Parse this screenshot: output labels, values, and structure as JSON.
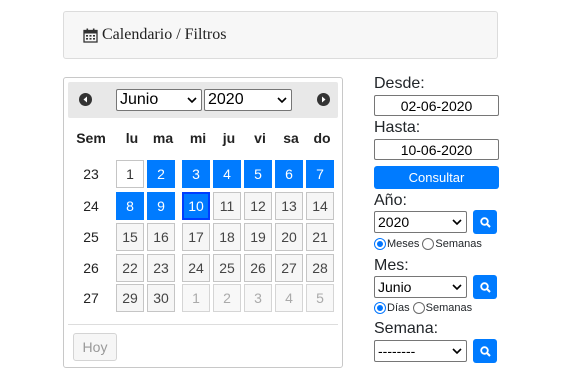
{
  "breadcrumb": {
    "icon": "calendar-icon",
    "section": "Calendario",
    "separator": "/",
    "page": "Filtros"
  },
  "calendar": {
    "selected_month": "Junio",
    "selected_year": "2020",
    "weekday_header": [
      "Sem",
      "lu",
      "ma",
      "mi",
      "ju",
      "vi",
      "sa",
      "do"
    ],
    "weeks": [
      {
        "week": "23",
        "days": [
          {
            "d": "1",
            "s": "today"
          },
          {
            "d": "2",
            "s": "selected"
          },
          {
            "d": "3",
            "s": "selected"
          },
          {
            "d": "4",
            "s": "selected"
          },
          {
            "d": "5",
            "s": "selected"
          },
          {
            "d": "6",
            "s": "selected"
          },
          {
            "d": "7",
            "s": "selected"
          }
        ]
      },
      {
        "week": "24",
        "days": [
          {
            "d": "8",
            "s": "selected"
          },
          {
            "d": "9",
            "s": "selected"
          },
          {
            "d": "10",
            "s": "selected current"
          },
          {
            "d": "11",
            "s": ""
          },
          {
            "d": "12",
            "s": ""
          },
          {
            "d": "13",
            "s": ""
          },
          {
            "d": "14",
            "s": ""
          }
        ]
      },
      {
        "week": "25",
        "days": [
          {
            "d": "15",
            "s": ""
          },
          {
            "d": "16",
            "s": ""
          },
          {
            "d": "17",
            "s": ""
          },
          {
            "d": "18",
            "s": ""
          },
          {
            "d": "19",
            "s": ""
          },
          {
            "d": "20",
            "s": ""
          },
          {
            "d": "21",
            "s": ""
          }
        ]
      },
      {
        "week": "26",
        "days": [
          {
            "d": "22",
            "s": ""
          },
          {
            "d": "23",
            "s": ""
          },
          {
            "d": "24",
            "s": ""
          },
          {
            "d": "25",
            "s": ""
          },
          {
            "d": "26",
            "s": ""
          },
          {
            "d": "27",
            "s": ""
          },
          {
            "d": "28",
            "s": ""
          }
        ]
      },
      {
        "week": "27",
        "days": [
          {
            "d": "29",
            "s": ""
          },
          {
            "d": "30",
            "s": ""
          },
          {
            "d": "1",
            "s": "other"
          },
          {
            "d": "2",
            "s": "other"
          },
          {
            "d": "3",
            "s": "other"
          },
          {
            "d": "4",
            "s": "other"
          },
          {
            "d": "5",
            "s": "other"
          }
        ]
      }
    ],
    "today_button": "Hoy"
  },
  "filters": {
    "desde_label": "Desde:",
    "desde_value": "02-06-2020",
    "hasta_label": "Hasta:",
    "hasta_value": "10-06-2020",
    "consult_button": "Consultar",
    "anio_label": "Año:",
    "anio_value": "2020",
    "anio_radio": [
      "Meses",
      "Semanas"
    ],
    "mes_label": "Mes:",
    "mes_value": "Junio",
    "mes_radio": [
      "Días",
      "Semanas"
    ],
    "semana_label": "Semana:",
    "semana_value": "--------"
  },
  "colors": {
    "accent": "#007bff",
    "header_bg": "#e8e8e8",
    "card_bg": "#f7f7f7"
  }
}
